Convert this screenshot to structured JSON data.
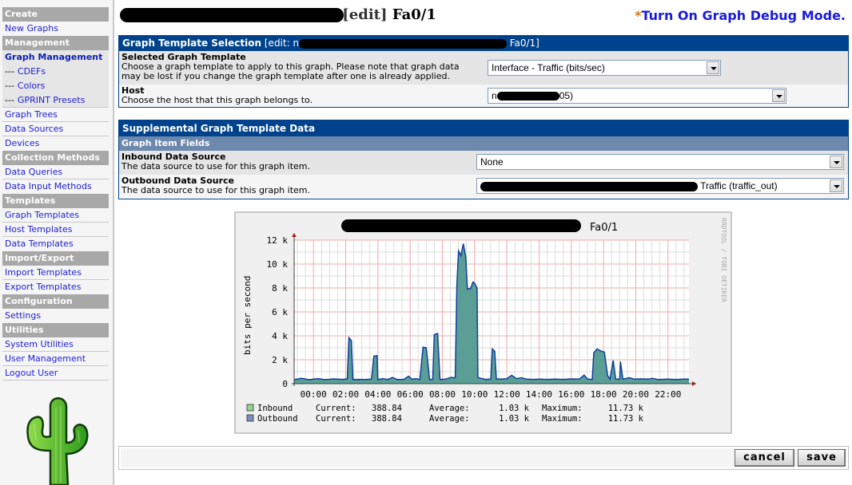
{
  "sidebar": {
    "sections": [
      {
        "header": "Create",
        "items": [
          {
            "label": "New Graphs"
          }
        ]
      },
      {
        "header": "Management",
        "items": [
          {
            "label": "Graph Management",
            "selected": true
          },
          {
            "label": "CDEFs",
            "prefix": "---"
          },
          {
            "label": "Colors",
            "prefix": "---"
          },
          {
            "label": "GPRINT Presets",
            "prefix": "---"
          },
          {
            "label": "Graph Trees"
          },
          {
            "label": "Data Sources"
          },
          {
            "label": "Devices"
          }
        ]
      },
      {
        "header": "Collection Methods",
        "items": [
          {
            "label": "Data Queries"
          },
          {
            "label": "Data Input Methods"
          }
        ]
      },
      {
        "header": "Templates",
        "items": [
          {
            "label": "Graph Templates"
          },
          {
            "label": "Host Templates"
          },
          {
            "label": "Data Templates"
          }
        ]
      },
      {
        "header": "Import/Export",
        "items": [
          {
            "label": "Import Templates"
          },
          {
            "label": "Export Templates"
          }
        ]
      },
      {
        "header": "Configuration",
        "items": [
          {
            "label": "Settings"
          }
        ]
      },
      {
        "header": "Utilities",
        "items": [
          {
            "label": "System Utilities"
          },
          {
            "label": "User Management"
          },
          {
            "label": "Logout User"
          }
        ]
      }
    ],
    "logo_icon": "cactus-logo"
  },
  "header": {
    "title_prefix": "[edit]",
    "title_suffix": "Fa0/1",
    "debug_star": "*",
    "debug_link": "Turn On Graph Debug Mode."
  },
  "template_panel": {
    "title": "Graph Template Selection",
    "title_edit_prefix": "[edit: n",
    "title_edit_suffix": "Fa0/1]",
    "fields": [
      {
        "label": "Selected Graph Template",
        "desc1": "Choose a graph template to apply to this graph. Please note that graph data",
        "desc2": "may be lost if you change the graph template after one is already applied.",
        "value": "Interface - Traffic (bits/sec)"
      },
      {
        "label": "Host",
        "desc1": "Choose the host that this graph belongs to.",
        "value_prefix": "n",
        "value_suffix": "05)"
      }
    ]
  },
  "supplemental_panel": {
    "title": "Supplemental Graph Template Data",
    "subheader": "Graph Item Fields",
    "fields": [
      {
        "label": "Inbound Data Source",
        "desc": "The data source to use for this graph item.",
        "value": "None"
      },
      {
        "label": "Outbound Data Source",
        "desc": "The data source to use for this graph item.",
        "value_suffix": "Traffic (traffic_out)"
      }
    ]
  },
  "chart_data": {
    "type": "area",
    "title_suffix": "Fa0/1",
    "ylabel": "bits per second",
    "watermark": "RRDTOOL / TOBI OETIKER",
    "ylim": [
      0,
      12000
    ],
    "yticks": [
      0,
      2000,
      4000,
      6000,
      8000,
      10000,
      12000
    ],
    "ytick_labels": [
      "0",
      "2 k",
      "4 k",
      "6 k",
      "8 k",
      "10 k",
      "12 k"
    ],
    "xlim_hours": [
      -1.2,
      23.3
    ],
    "xticks_hours": [
      0,
      2,
      4,
      6,
      8,
      10,
      12,
      14,
      16,
      18,
      20,
      22
    ],
    "xtick_labels": [
      "00:00",
      "02:00",
      "04:00",
      "06:00",
      "08:00",
      "10:00",
      "12:00",
      "14:00",
      "16:00",
      "18:00",
      "20:00",
      "22:00"
    ],
    "grid": true,
    "series": [
      {
        "name": "Inbound",
        "color": "#8fd48f",
        "current": "388.84",
        "average": "1.03 k",
        "maximum": "11.73 k"
      },
      {
        "name": "Outbound",
        "color": "#7a8fbf",
        "current": "388.84",
        "average": "1.03 k",
        "maximum": "11.73 k"
      }
    ],
    "legend_labels": {
      "current": "Current:",
      "average": "Average:",
      "maximum": "Maximum:"
    },
    "fill_color": "#5a9e96",
    "line_color": "#0f3ea0",
    "points": [
      [
        -1.2,
        350
      ],
      [
        -1.0,
        380
      ],
      [
        -0.8,
        450
      ],
      [
        -0.6,
        420
      ],
      [
        -0.4,
        360
      ],
      [
        -0.2,
        340
      ],
      [
        0.0,
        380
      ],
      [
        0.3,
        420
      ],
      [
        0.6,
        360
      ],
      [
        0.9,
        350
      ],
      [
        1.2,
        400
      ],
      [
        1.5,
        380
      ],
      [
        1.8,
        360
      ],
      [
        2.0,
        380
      ],
      [
        2.1,
        400
      ],
      [
        2.2,
        3850
      ],
      [
        2.35,
        3600
      ],
      [
        2.45,
        350
      ],
      [
        2.8,
        360
      ],
      [
        3.2,
        350
      ],
      [
        3.6,
        380
      ],
      [
        3.75,
        2300
      ],
      [
        3.95,
        2350
      ],
      [
        4.0,
        350
      ],
      [
        4.3,
        420
      ],
      [
        4.6,
        350
      ],
      [
        4.9,
        520
      ],
      [
        5.2,
        350
      ],
      [
        5.6,
        360
      ],
      [
        5.9,
        620
      ],
      [
        6.1,
        380
      ],
      [
        6.4,
        420
      ],
      [
        6.6,
        350
      ],
      [
        6.8,
        3050
      ],
      [
        7.0,
        3000
      ],
      [
        7.1,
        1700
      ],
      [
        7.2,
        360
      ],
      [
        7.4,
        360
      ],
      [
        7.5,
        4100
      ],
      [
        7.7,
        4200
      ],
      [
        7.85,
        350
      ],
      [
        8.2,
        380
      ],
      [
        8.5,
        520
      ],
      [
        8.8,
        500
      ],
      [
        8.9,
        8200
      ],
      [
        9.0,
        11100
      ],
      [
        9.15,
        10700
      ],
      [
        9.3,
        11700
      ],
      [
        9.45,
        10600
      ],
      [
        9.55,
        7900
      ],
      [
        9.75,
        7950
      ],
      [
        9.9,
        8500
      ],
      [
        10.0,
        8400
      ],
      [
        10.15,
        8000
      ],
      [
        10.2,
        520
      ],
      [
        10.4,
        450
      ],
      [
        10.7,
        360
      ],
      [
        11.0,
        380
      ],
      [
        11.1,
        2900
      ],
      [
        11.25,
        2700
      ],
      [
        11.35,
        400
      ],
      [
        11.6,
        380
      ],
      [
        12.0,
        420
      ],
      [
        12.3,
        700
      ],
      [
        12.6,
        420
      ],
      [
        12.9,
        500
      ],
      [
        13.2,
        380
      ],
      [
        13.6,
        360
      ],
      [
        14.0,
        380
      ],
      [
        14.5,
        360
      ],
      [
        15.0,
        380
      ],
      [
        15.5,
        360
      ],
      [
        16.0,
        400
      ],
      [
        16.5,
        380
      ],
      [
        16.8,
        720
      ],
      [
        17.0,
        380
      ],
      [
        17.3,
        360
      ],
      [
        17.4,
        2600
      ],
      [
        17.6,
        2900
      ],
      [
        17.9,
        2700
      ],
      [
        18.05,
        2650
      ],
      [
        18.25,
        700
      ],
      [
        18.4,
        380
      ],
      [
        18.6,
        1950
      ],
      [
        18.75,
        380
      ],
      [
        19.0,
        380
      ],
      [
        19.05,
        1850
      ],
      [
        19.2,
        380
      ],
      [
        19.6,
        500
      ],
      [
        19.9,
        380
      ],
      [
        20.3,
        400
      ],
      [
        20.8,
        380
      ],
      [
        21.0,
        450
      ],
      [
        21.4,
        350
      ],
      [
        22.0,
        380
      ],
      [
        22.5,
        350
      ],
      [
        23.0,
        380
      ],
      [
        23.3,
        380
      ]
    ]
  },
  "buttons": {
    "cancel": "cancel",
    "save": "save"
  }
}
